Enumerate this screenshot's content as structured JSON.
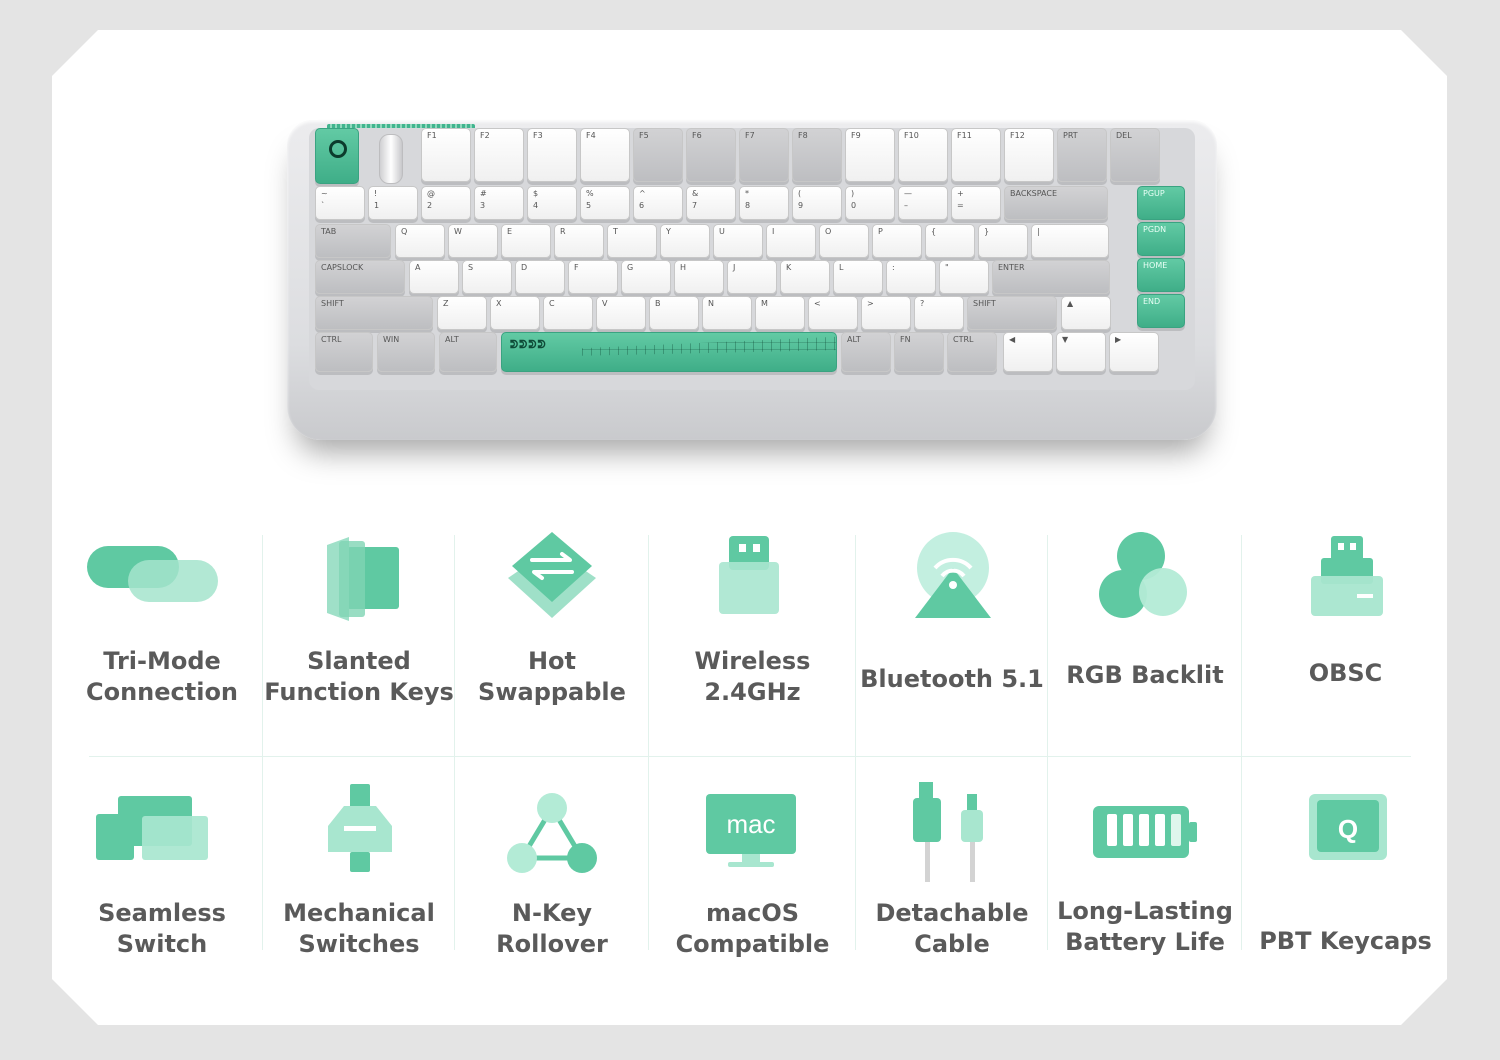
{
  "colors": {
    "accent": "#5fc9a2",
    "accent_dark": "#3fae88",
    "text": "#5a5a5a",
    "background": "#ffffff",
    "frame": "#e4e4e4"
  },
  "keyboard": {
    "function_row": [
      "F1",
      "F2",
      "F3",
      "F4",
      "F5",
      "F6",
      "F7",
      "F8",
      "F9",
      "F10",
      "F11",
      "F12",
      "PRT",
      "DEL"
    ],
    "number_row": [
      "~",
      "!",
      "@",
      "#",
      "$",
      "%",
      "^",
      "&",
      "*",
      "(",
      ")",
      "—",
      "+",
      "BACKSPACE"
    ],
    "number_row_sub": [
      "`",
      "1",
      "2",
      "3",
      "4",
      "5",
      "6",
      "7",
      "8",
      "9",
      "0",
      "–",
      "="
    ],
    "qwerty_row": [
      "TAB",
      "Q",
      "W",
      "E",
      "R",
      "T",
      "Y",
      "U",
      "I",
      "O",
      "P",
      "{",
      "}",
      "|"
    ],
    "home_row": [
      "CAPSLOCK",
      "A",
      "S",
      "D",
      "F",
      "G",
      "H",
      "J",
      "K",
      "L",
      ":",
      "\"",
      "ENTER"
    ],
    "shift_row": [
      "SHIFT",
      "Z",
      "X",
      "C",
      "V",
      "B",
      "N",
      "M",
      "<",
      ">",
      "?",
      "SHIFT",
      "▲"
    ],
    "bottom_row": [
      "CTRL",
      "WIN",
      "ALT",
      "ALT",
      "FN",
      "CTRL",
      "◀",
      "▼",
      "▶"
    ],
    "nav_column": [
      "PGUP",
      "PGDN",
      "HOME",
      "END"
    ],
    "spacebar_art": "ᕲᕲᕲᕲ"
  },
  "features": [
    {
      "label": "Tri-Mode\nConnection",
      "icon": "toggle-icon"
    },
    {
      "label": "Slanted\nFunction Keys",
      "icon": "slanted-keys-icon"
    },
    {
      "label": "Hot\nSwappable",
      "icon": "swap-icon"
    },
    {
      "label": "Wireless\n2.4GHz",
      "icon": "usb-dongle-icon"
    },
    {
      "label": "Bluetooth 5.1",
      "icon": "bluetooth-signal-icon"
    },
    {
      "label": "RGB Backlit",
      "icon": "rgb-circles-icon"
    },
    {
      "label": "OBSC",
      "icon": "obsc-dongle-icon"
    },
    {
      "label": "Seamless\nSwitch",
      "icon": "devices-icon"
    },
    {
      "label": "Mechanical\nSwitches",
      "icon": "switch-icon"
    },
    {
      "label": "N-Key\nRollover",
      "icon": "nodes-icon"
    },
    {
      "label": "macOS\nCompatible",
      "icon": "mac-monitor-icon"
    },
    {
      "label": "Detachable\nCable",
      "icon": "cable-icon"
    },
    {
      "label": "Long-Lasting\nBattery Life",
      "icon": "battery-icon"
    },
    {
      "label": "PBT Keycaps",
      "icon": "keycap-icon"
    }
  ],
  "mac_badge": "mac",
  "keycap_letter": "Q"
}
